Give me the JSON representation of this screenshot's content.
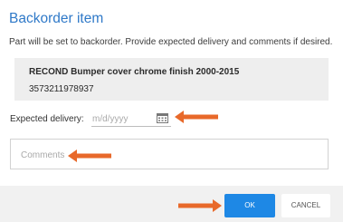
{
  "dialog": {
    "title": "Backorder item",
    "subtitle": "Part will be set to backorder. Provide expected delivery and comments if desired."
  },
  "part": {
    "name": "RECOND Bumper cover chrome finish 2000-2015",
    "number": "3573211978937"
  },
  "delivery": {
    "label": "Expected delivery:",
    "placeholder": "m/d/yyyy",
    "value": ""
  },
  "comments": {
    "placeholder": "Comments",
    "value": ""
  },
  "actions": {
    "ok_label": "OK",
    "cancel_label": "CANCEL"
  },
  "colors": {
    "accent": "#2f79c8",
    "ok_button": "#1e88e5",
    "annotation_arrow": "#e8692a"
  },
  "icons": {
    "date_picker": "calendar-icon",
    "annotation": "arrow-left-icon"
  }
}
